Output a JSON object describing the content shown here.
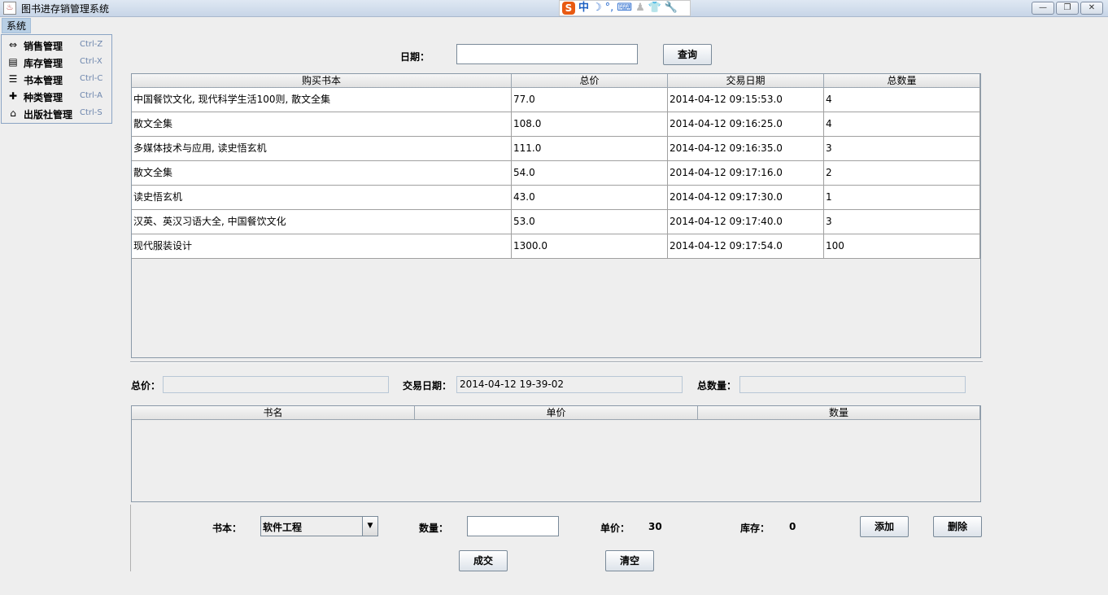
{
  "window": {
    "title": "图书进存销管理系统",
    "ime": {
      "lang": "中",
      "moon": "☽",
      "punct": "°,",
      "keyboard": "⌨",
      "person": "♟",
      "shirt": "👕",
      "wrench": "🔧"
    },
    "buttons": {
      "minimize": "—",
      "restore": "❐",
      "close": "✕"
    }
  },
  "menubar": {
    "system": "系统"
  },
  "menu": [
    {
      "icon": "sales-icon",
      "glyph": "⇔",
      "label": "销售管理",
      "accel": "Ctrl-Z"
    },
    {
      "icon": "inventory-icon",
      "glyph": "▤",
      "label": "库存管理",
      "accel": "Ctrl-X"
    },
    {
      "icon": "book-icon",
      "glyph": "☰",
      "label": "书本管理",
      "accel": "Ctrl-C"
    },
    {
      "icon": "category-icon",
      "glyph": "✚",
      "label": "种类管理",
      "accel": "Ctrl-A"
    },
    {
      "icon": "home-icon",
      "glyph": "⌂",
      "label": "出版社管理",
      "accel": "Ctrl-S"
    }
  ],
  "query": {
    "date_label": "日期：",
    "date_value": "",
    "query_button": "查询"
  },
  "sales_table": {
    "columns": [
      "购买书本",
      "总价",
      "交易日期",
      "总数量"
    ],
    "rows": [
      [
        "中国餐饮文化, 现代科学生活100则, 散文全集",
        "77.0",
        "2014-04-12 09:15:53.0",
        "4"
      ],
      [
        "散文全集",
        "108.0",
        "2014-04-12 09:16:25.0",
        "4"
      ],
      [
        "多媒体技术与应用, 读史悟玄机",
        "111.0",
        "2014-04-12 09:16:35.0",
        "3"
      ],
      [
        "散文全集",
        "54.0",
        "2014-04-12 09:17:16.0",
        "2"
      ],
      [
        "读史悟玄机",
        "43.0",
        "2014-04-12 09:17:30.0",
        "1"
      ],
      [
        "汉英、英汉习语大全, 中国餐饮文化",
        "53.0",
        "2014-04-12 09:17:40.0",
        "3"
      ],
      [
        "现代服装设计",
        "1300.0",
        "2014-04-12 09:17:54.0",
        "100"
      ]
    ]
  },
  "summary": {
    "total_price_label": "总价：",
    "total_price_value": "",
    "trade_date_label": "交易日期：",
    "trade_date_value": "2014-04-12 19-39-02",
    "total_qty_label": "总数量：",
    "total_qty_value": ""
  },
  "detail_table": {
    "columns": [
      "书名",
      "单价",
      "数量"
    ]
  },
  "entry": {
    "book_label": "书本：",
    "book_value": "软件工程",
    "qty_label": "数量：",
    "qty_value": "",
    "price_label": "单价：",
    "price_value": "30",
    "stock_label": "库存：",
    "stock_value": "0",
    "add_button": "添加",
    "delete_button": "删除",
    "deal_button": "成交",
    "clear_button": "清空"
  }
}
